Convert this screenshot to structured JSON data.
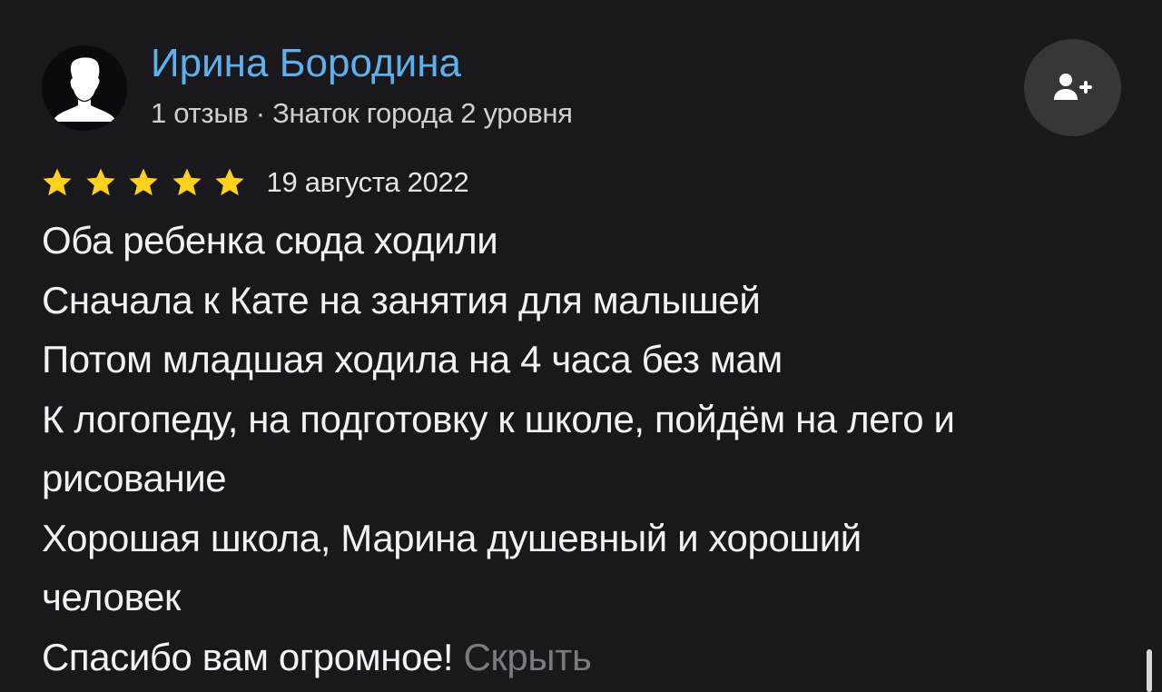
{
  "author": {
    "name": "Ирина Бородина",
    "meta": "1 отзыв · Знаток города 2 уровня",
    "avatar_icon": "user-silhouette-icon"
  },
  "subscribe": {
    "icon": "add-user-icon"
  },
  "rating": {
    "stars": 5,
    "max": 5,
    "color": "#ffd21e"
  },
  "date": "19 августа 2022",
  "review": {
    "lines": [
      "Оба ребенка сюда ходили",
      "Сначала к Кате на занятия для малышей",
      "Потом младшая ходила на 4 часа без мам",
      "К логопеду, на подготовку к школе, пойдём на лего и",
      "рисование",
      "Хорошая школа, Марина душевный и хороший",
      "человек",
      "Спасибо вам огромное!"
    ],
    "hide_label": "Скрыть"
  },
  "colors": {
    "background": "#19181c",
    "author_link": "#5eb0ec",
    "muted": "#7b7a80"
  }
}
